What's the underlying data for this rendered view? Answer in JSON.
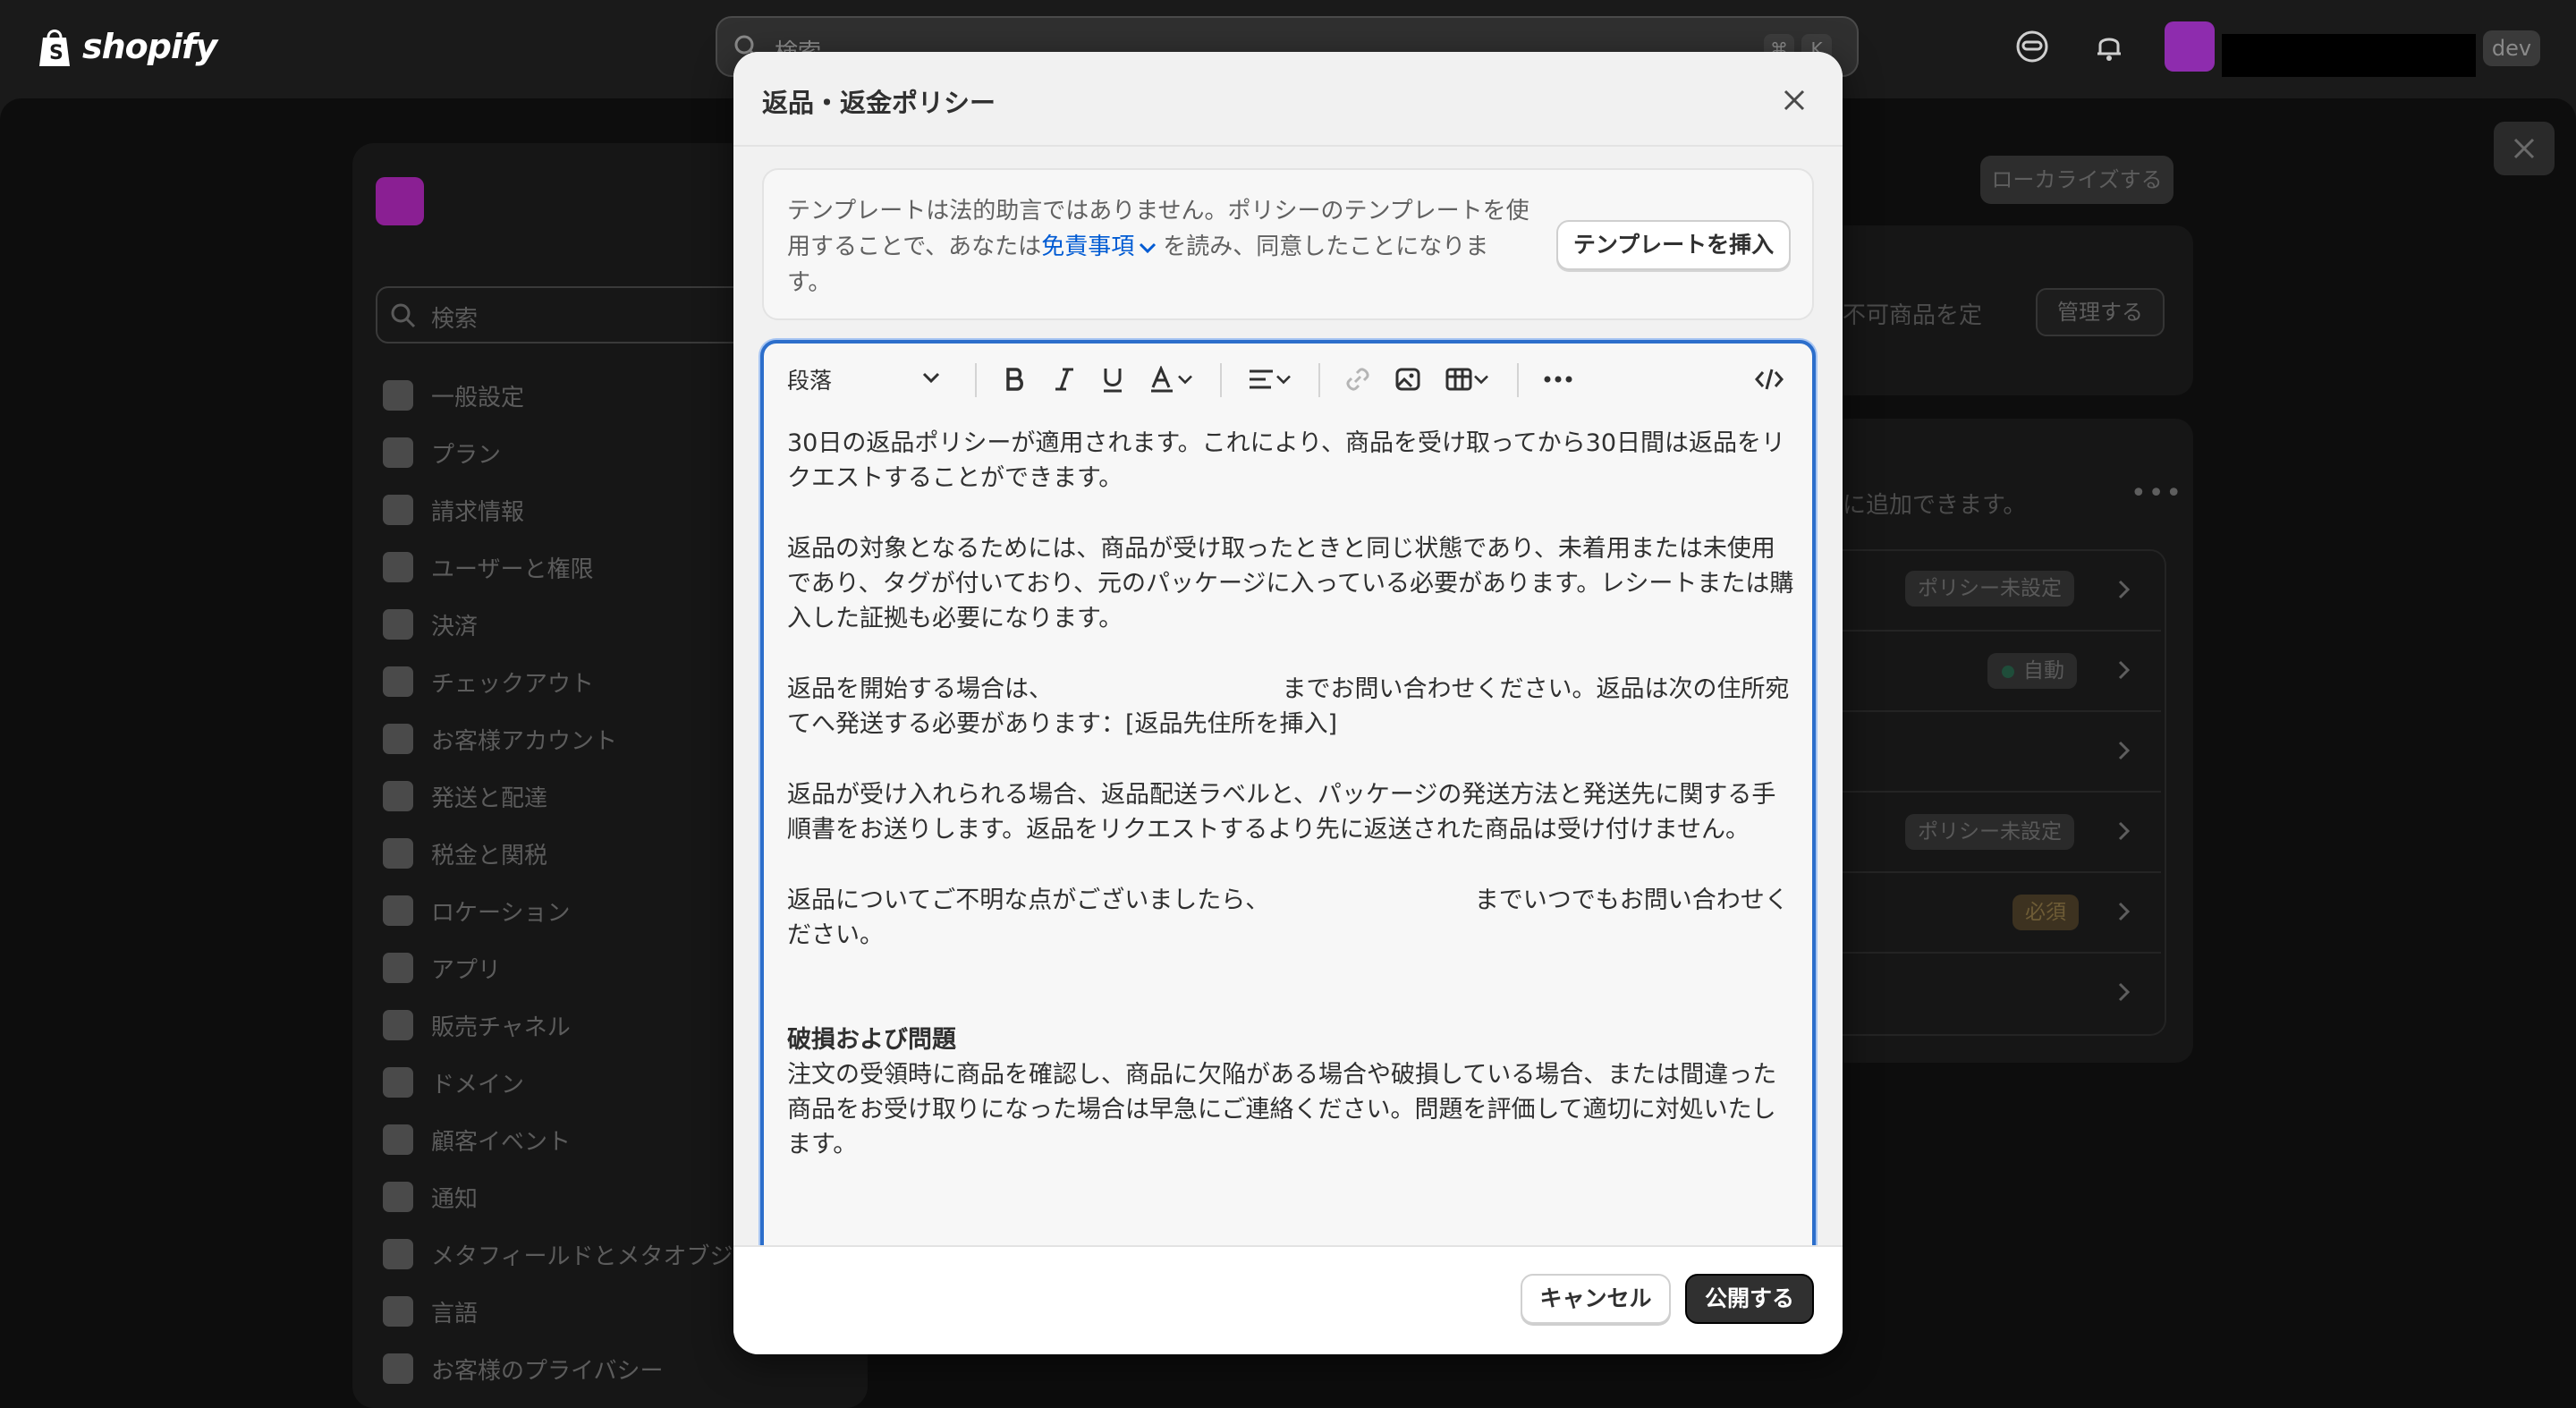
{
  "topbar": {
    "logo_text": "shopify",
    "search_placeholder": "検索",
    "shortcut_keys": [
      "⌘",
      "K"
    ],
    "store_badge": "dev"
  },
  "settings": {
    "search_placeholder": "検索",
    "nav_items": [
      {
        "label": "一般設定",
        "icon": "store-icon"
      },
      {
        "label": "プラン",
        "icon": "plan-icon"
      },
      {
        "label": "請求情報",
        "icon": "billing-icon"
      },
      {
        "label": "ユーザーと権限",
        "icon": "users-icon"
      },
      {
        "label": "決済",
        "icon": "payments-icon"
      },
      {
        "label": "チェックアウト",
        "icon": "cart-icon"
      },
      {
        "label": "お客様アカウント",
        "icon": "person-icon"
      },
      {
        "label": "発送と配達",
        "icon": "truck-icon"
      },
      {
        "label": "税金と関税",
        "icon": "tax-icon"
      },
      {
        "label": "ロケーション",
        "icon": "location-icon"
      },
      {
        "label": "アプリ",
        "icon": "apps-icon"
      },
      {
        "label": "販売チャネル",
        "icon": "channels-icon"
      },
      {
        "label": "ドメイン",
        "icon": "domain-icon"
      },
      {
        "label": "顧客イベント",
        "icon": "events-icon"
      },
      {
        "label": "通知",
        "icon": "bell-icon"
      },
      {
        "label": "メタフィールドとメタオブジ",
        "icon": "metafields-icon"
      },
      {
        "label": "言語",
        "icon": "language-icon"
      },
      {
        "label": "お客様のプライバシー",
        "icon": "lock-icon"
      }
    ],
    "localize_button": "ローカライズする",
    "manage_button": "管理する",
    "partial_text_1": "不可商品を定",
    "partial_text_2": "に追加できます。",
    "policy_badges": [
      "ポリシー未設定",
      "自動",
      "ポリシー未設定",
      "必須"
    ]
  },
  "modal": {
    "title": "返品・返金ポリシー",
    "notice_part1": "テンプレートは法的助言ではありません。ポリシーのテンプレートを使用することで、あなたは",
    "notice_link": "免責事項",
    "notice_part2": "を読み、同意したことになります。",
    "insert_template_button": "テンプレートを挿入",
    "toolbar": {
      "paragraph_select": "段落"
    },
    "content": {
      "p1": "30日の返品ポリシーが適用されます。これにより、商品を受け取ってから30日間は返品をリクエストすることができます。",
      "p2": "返品の対象となるためには、商品が受け取ったときと同じ状態であり、未着用または未使用であり、タグが付いており、元のパッケージに入っている必要があります。レシートまたは購入した証拠も必要になります。",
      "p3": "返品を開始する場合は、　　　　　　　　　　までお問い合わせください。返品は次の住所宛てへ発送する必要があります：[返品先住所を挿入]",
      "p4": "返品が受け入れられる場合、返品配送ラベルと、パッケージの発送方法と発送先に関する手順書をお送りします。返品をリクエストするより先に返送された商品は受け付けません。",
      "p5": "返品についてご不明な点がございましたら、　　　　　　　　　までいつでもお問い合わせください。",
      "heading": "破損および問題",
      "p6": "注文の受領時に商品を確認し、商品に欠陥がある場合や破損している場合、または間違った商品をお受け取りになった場合は早急にご連絡ください。問題を評価して適切に対処いたします。"
    },
    "cancel_button": "キャンセル",
    "publish_button": "公開する"
  }
}
